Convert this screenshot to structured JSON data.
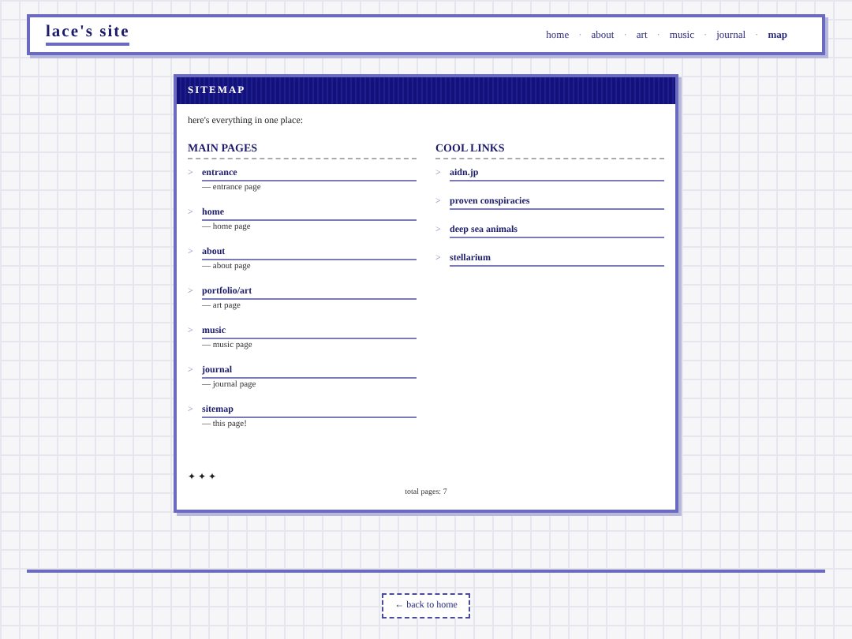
{
  "header": {
    "title": "lace's site",
    "separator": "·",
    "nav": [
      {
        "label": "home",
        "selected": false
      },
      {
        "label": "about",
        "selected": false
      },
      {
        "label": "art",
        "selected": false
      },
      {
        "label": "music",
        "selected": false
      },
      {
        "label": "journal",
        "selected": false
      },
      {
        "label": "map",
        "selected": true
      }
    ]
  },
  "card": {
    "title": "SITEMAP",
    "intro": "here's everything in one place:",
    "marker": ">",
    "main_pages": {
      "heading": "MAIN PAGES",
      "items": [
        {
          "label": "entrance",
          "description": "— entrance page"
        },
        {
          "label": "home",
          "description": "— home page"
        },
        {
          "label": "about",
          "description": "— about page"
        },
        {
          "label": "portfolio/art",
          "description": "— art page"
        },
        {
          "label": "music",
          "description": "— music page"
        },
        {
          "label": "journal",
          "description": "— journal page"
        },
        {
          "label": "sitemap",
          "description": "— this page!"
        }
      ]
    },
    "cool_links": {
      "heading": "COOL LINKS",
      "items": [
        {
          "label": "aidn.jp"
        },
        {
          "label": "proven conspiracies"
        },
        {
          "label": "deep sea animals"
        },
        {
          "label": "stellarium"
        }
      ]
    },
    "ornament": "✦ ✦ ✦",
    "total": "total pages: 7"
  },
  "back_button": "← back to home"
}
